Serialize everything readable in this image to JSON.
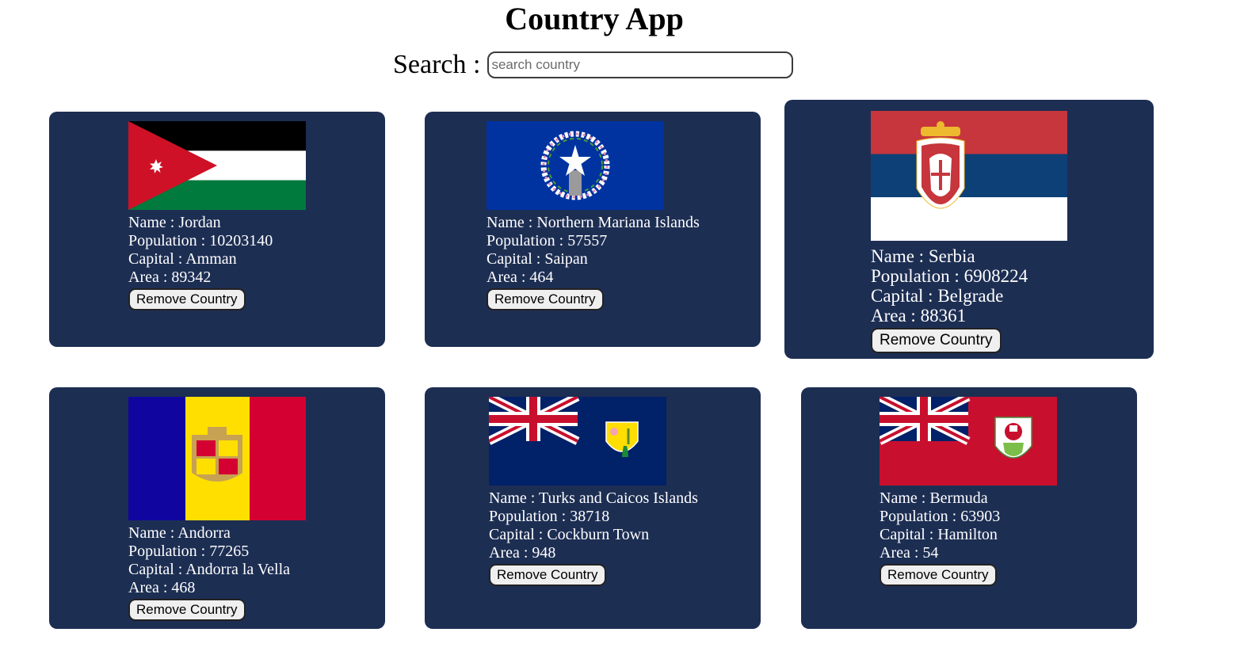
{
  "app": {
    "title": "Country App"
  },
  "search": {
    "label": "Search :",
    "placeholder": "search country",
    "value": ""
  },
  "labels": {
    "name": "Name : ",
    "population": "Population : ",
    "capital": "Capital : ",
    "area": "Area : ",
    "remove_button": "Remove Country"
  },
  "countries": [
    {
      "name": "Jordan",
      "population": "10203140",
      "capital": "Amman",
      "area": "89342",
      "flag_icon": "jordan-flag-icon"
    },
    {
      "name": "Northern Mariana Islands",
      "population": "57557",
      "capital": "Saipan",
      "area": "464",
      "flag_icon": "northern-mariana-islands-flag-icon"
    },
    {
      "name": "Serbia",
      "population": "6908224",
      "capital": "Belgrade",
      "area": "88361",
      "flag_icon": "serbia-flag-icon"
    },
    {
      "name": "Andorra",
      "population": "77265",
      "capital": "Andorra la Vella",
      "area": "468",
      "flag_icon": "andorra-flag-icon"
    },
    {
      "name": "Turks and Caicos Islands",
      "population": "38718",
      "capital": "Cockburn Town",
      "area": "948",
      "flag_icon": "turks-and-caicos-flag-icon"
    },
    {
      "name": "Bermuda",
      "population": "63903",
      "capital": "Hamilton",
      "area": "54",
      "flag_icon": "bermuda-flag-icon"
    }
  ],
  "colors": {
    "card_background": "#1d2e53",
    "card_text": "#ffffff",
    "page_background": "#ffffff"
  }
}
